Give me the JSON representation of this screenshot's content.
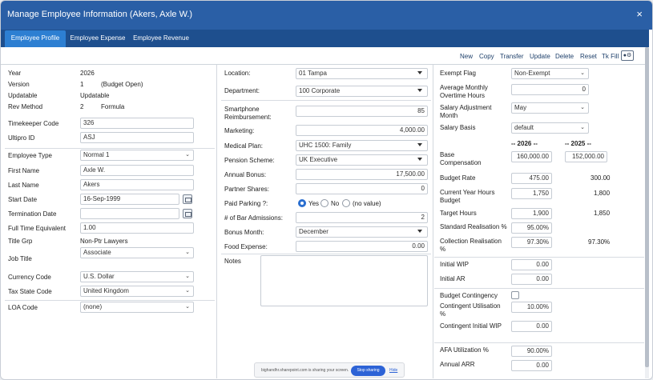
{
  "window": {
    "title": "Manage Employee Information (Akers, Axle W.)",
    "close_glyph": "×"
  },
  "tabs": [
    "Employee Profile",
    "Employee Expense",
    "Employee Revenue"
  ],
  "toolbar": {
    "new": "New",
    "copy": "Copy",
    "transfer": "Transfer",
    "update": "Update",
    "delete": "Delete",
    "reset": "Reset",
    "tkfill": "Tk Fill",
    "user_icon": "user-settings-icon"
  },
  "col1": {
    "year_label": "Year",
    "year": "2026",
    "version_label": "Version",
    "version_num": "1",
    "version_text": "(Budget Open)",
    "updatable_label": "Updatable",
    "updatable": "Updatable",
    "rev_method_label": "Rev Method",
    "rev_method_num": "2",
    "rev_method_text": "Formula",
    "timekeeper_label": "Timekeeper Code",
    "timekeeper": "326",
    "ultipro_label": "Ultipro ID",
    "ultipro": "ASJ",
    "employee_type_label": "Employee Type",
    "employee_type": "Normal 1",
    "first_name_label": "First Name",
    "first_name": "Axle W.",
    "last_name_label": "Last Name",
    "last_name": "Akers",
    "start_date_label": "Start Date",
    "start_date": "16-Sep-1999",
    "termination_label": "Termination Date",
    "termination": "",
    "fte_label": "Full Time Equivalent",
    "fte": "1.00",
    "title_grp_label": "Title Grp",
    "title_grp": "Non-Ptr Lawyers",
    "job_title_label": "Job Title",
    "job_title": "Associate",
    "currency_label": "Currency Code",
    "currency": "U.S. Dollar",
    "tax_state_label": "Tax State Code",
    "tax_state": "United Kingdom",
    "loa_label": "LOA Code",
    "loa": "(none)"
  },
  "col2": {
    "location_label": "Location:",
    "location": "01 Tampa",
    "department_label": "Department:",
    "department": "100 Corporate",
    "smartphone_label": "Smartphone Reimbursement:",
    "smartphone": "85",
    "marketing_label": "Marketing:",
    "marketing": "4,000.00",
    "medical_label": "Medical Plan:",
    "medical": "UHC 1500: Family",
    "pension_label": "Pension Scheme:",
    "pension": "UK Executive",
    "bonus_label": "Annual Bonus:",
    "bonus": "17,500.00",
    "partner_label": "Partner Shares:",
    "partner": "0",
    "parking_label": "Paid Parking ?:",
    "parking_yes": "Yes",
    "parking_no": "No",
    "parking_none": "(no value)",
    "bar_label": "# of Bar Admissions:",
    "bar": "2",
    "bonus_month_label": "Bonus Month:",
    "bonus_month": "December",
    "food_label": "Food Expense:",
    "food": "0.00",
    "notes_label": "Notes"
  },
  "col3": {
    "exempt_label": "Exempt Flag",
    "exempt": "Non-Exempt",
    "overtime_label": "Average Monthly Overtime Hours",
    "overtime": "0",
    "salary_adj_label": "Salary Adjustment Month",
    "salary_adj": "May",
    "salary_basis_label": "Salary Basis",
    "salary_basis": "default",
    "year_2026": "-- 2026 --",
    "year_2025": "-- 2025 --",
    "base_label": "Base Compensation",
    "base_2026": "160,000.00",
    "base_2025": "152,000.00",
    "rate_label": "Budget Rate",
    "rate_2026": "475.00",
    "rate_2025": "300.00",
    "cur_hours_label": "Current Year Hours Budget",
    "cur_hours_2026": "1,750",
    "cur_hours_2025": "1,800",
    "target_label": "Target Hours",
    "target_2026": "1,900",
    "target_2025": "1,850",
    "std_real_label": "Standard Realisation %",
    "std_real": "95.00%",
    "coll_real_label": "Collection Realisation %",
    "coll_real_2026": "97.30%",
    "coll_real_2025": "97.30%",
    "wip_label": "Initial WIP",
    "wip": "0.00",
    "ar_label": "Initial AR",
    "ar": "0.00",
    "contingency_label": "Budget Contingency",
    "cont_util_label": "Contingent Utilisation %",
    "cont_util": "10.00%",
    "cont_wip_label": "Contingent Initial WIP",
    "cont_wip": "0.00",
    "afa_label": "AFA Utilization %",
    "afa": "90.00%",
    "arr_label": "Annual ARR",
    "arr": "0.00"
  },
  "sharebar": {
    "message": "bighandhr.sharepoint.com is sharing your screen.",
    "stop": "Stop sharing",
    "hide": "Hide"
  }
}
